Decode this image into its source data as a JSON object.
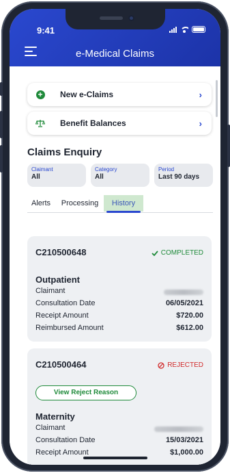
{
  "status_bar": {
    "time": "9:41"
  },
  "header": {
    "title": "e-Medical Claims",
    "menu_icon": "hamburger-menu-icon"
  },
  "nav_cards": [
    {
      "label": "New e-Claims",
      "icon": "plus-circle-icon",
      "icon_color": "#1f8a3a"
    },
    {
      "label": "Benefit Balances",
      "icon": "scale-icon",
      "icon_color": "#1f8a3a"
    }
  ],
  "section_title": "Claims Enquiry",
  "filters": [
    {
      "label": "Claimant",
      "value": "All"
    },
    {
      "label": "Category",
      "value": "All"
    },
    {
      "label": "Period",
      "value": "Last 90 days"
    }
  ],
  "tabs": [
    {
      "label": "Alerts",
      "active": false
    },
    {
      "label": "Processing",
      "active": false
    },
    {
      "label": "History",
      "active": true
    }
  ],
  "claims": [
    {
      "id": "C210500648",
      "status": "COMPLETED",
      "status_icon": "check-icon",
      "status_color": "#1f8a3a",
      "type": "Outpatient",
      "rows": [
        {
          "label": "Claimant",
          "value": ""
        },
        {
          "label": "Consultation Date",
          "value": "06/05/2021"
        },
        {
          "label": "Receipt Amount",
          "value": "$720.00"
        },
        {
          "label": "Reimbursed Amount",
          "value": "$612.00"
        }
      ]
    },
    {
      "id": "C210500464",
      "status": "REJECTED",
      "status_icon": "block-icon",
      "status_color": "#d12b2b",
      "action_label": "View Reject Reason",
      "type": "Maternity",
      "rows": [
        {
          "label": "Claimant",
          "value": ""
        },
        {
          "label": "Consultation Date",
          "value": "15/03/2021"
        },
        {
          "label": "Receipt Amount",
          "value": "$1,000.00"
        }
      ]
    }
  ],
  "colors": {
    "brand_blue": "#2a48cf",
    "accent_green": "#1f8a3a",
    "reject_red": "#d12b2b"
  }
}
